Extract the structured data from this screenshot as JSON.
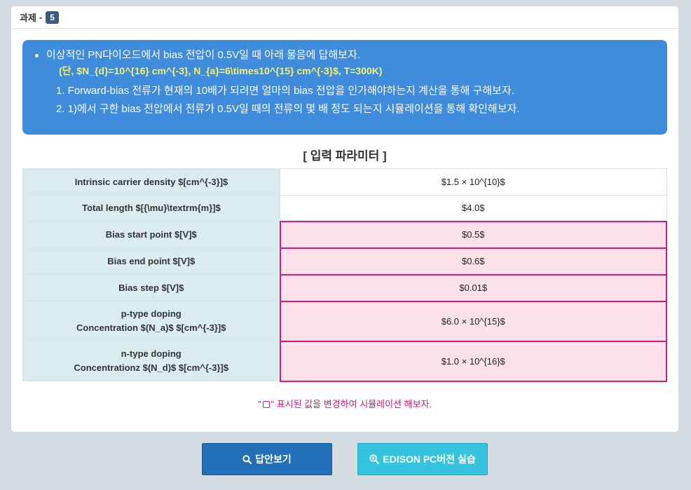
{
  "header": {
    "title": "과제",
    "separator": "-",
    "number": "5"
  },
  "question": {
    "intro": "이상적인 PN다이오드에서 bias 전압이 0.5V일 때 아래 물음에 답해보자.",
    "condition": "(단, $N_{d}=10^{16} cm^{-3}, N_{a}=6\\times10^{15} cm^{-3}$, T=300K)",
    "items": [
      "1. Forward-bias 전류가 현재의 10배가 되려면 얼마의 bias 전압을 인가해야하는지 계산을 통해 구해보자.",
      "2. 1)에서 구한 bias 전압에서 전류가 0.5V일 때의 전류의 몇 배 정도 되는지 시뮬레이션을 통해 확인해보자."
    ]
  },
  "section_title": "[ 입력 파라미터 ]",
  "params": [
    {
      "label": "Intrinsic carrier density $[cm^{-3}]$",
      "value": "$1.5 × 10^{10}$",
      "editable": false
    },
    {
      "label": "Total length $[{\\mu}\\textrm{m}]$",
      "value": "$4.0$",
      "editable": false
    },
    {
      "label": "Bias start point $[V]$",
      "value": "$0.5$",
      "editable": true
    },
    {
      "label": "Bias end point $[V]$",
      "value": "$0.6$",
      "editable": true
    },
    {
      "label": "Bias step $[V]$",
      "value": "$0.01$",
      "editable": true
    },
    {
      "label": "p-type doping",
      "label2": "Concentration $(N_a)$ $[cm^{-3}]$",
      "value": "$6.0 × 10^{15}$",
      "editable": true
    },
    {
      "label": "n-type doping",
      "label2": "Concentrationz $(N_d)$ $[cm^{-3}]$",
      "value": "$1.0 × 10^{16}$",
      "editable": true
    }
  ],
  "note": {
    "prefix": "\"",
    "suffix": "\" 표시된 값을 변경하여 시뮬레이션 해보자."
  },
  "buttons": {
    "answer": "답안보기",
    "edison": "EDISON PC버전 실습"
  },
  "colors": {
    "accent_blue": "#3f8bdc",
    "highlight_pink": "#d6197a",
    "condition_yellow": "#f6f06a"
  }
}
